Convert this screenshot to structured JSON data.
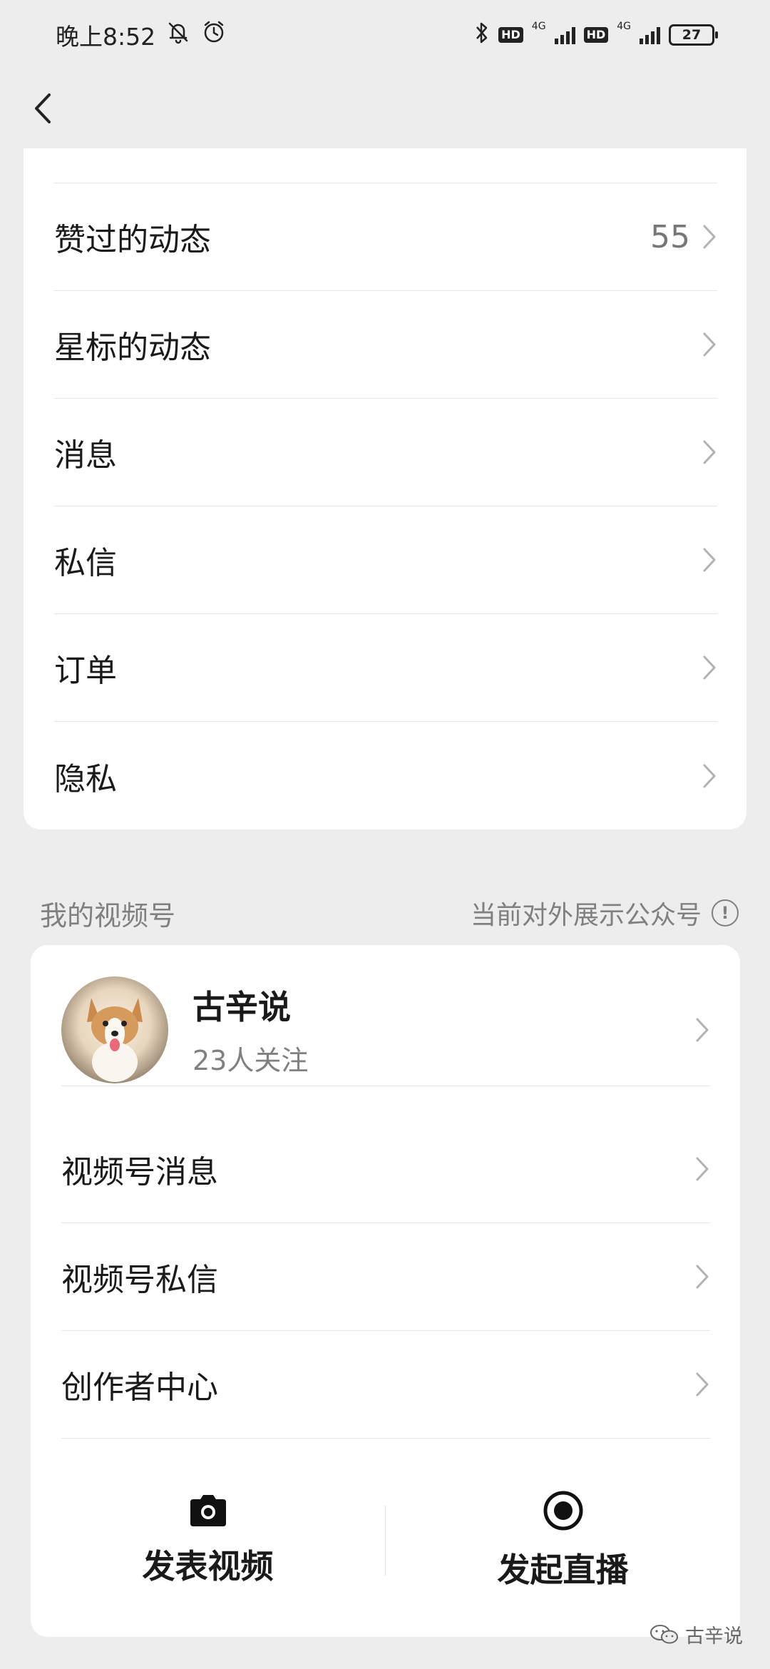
{
  "status_bar": {
    "time": "晚上8:52",
    "hd_badge": "HD",
    "network": "4G",
    "battery": "27"
  },
  "nav": {
    "back_icon": "chevron-left-icon"
  },
  "menu_items": [
    {
      "label": "赞过的动态",
      "count": "55"
    },
    {
      "label": "星标的动态",
      "count": ""
    },
    {
      "label": "消息",
      "count": ""
    },
    {
      "label": "私信",
      "count": ""
    },
    {
      "label": "订单",
      "count": ""
    },
    {
      "label": "隐私",
      "count": ""
    }
  ],
  "channel_section": {
    "title": "我的视频号",
    "right_text": "当前对外展示公众号",
    "info_symbol": "!"
  },
  "channel_profile": {
    "name": "古辛说",
    "followers": "23人关注"
  },
  "channel_items": [
    {
      "label": "视频号消息"
    },
    {
      "label": "视频号私信"
    },
    {
      "label": "创作者中心"
    }
  ],
  "actions": {
    "publish_video": "发表视频",
    "start_live": "发起直播"
  },
  "watermark": "古辛说",
  "colors": {
    "background": "#ededed",
    "card": "#ffffff",
    "text_primary": "#1a1a1a",
    "text_secondary": "#808080"
  }
}
